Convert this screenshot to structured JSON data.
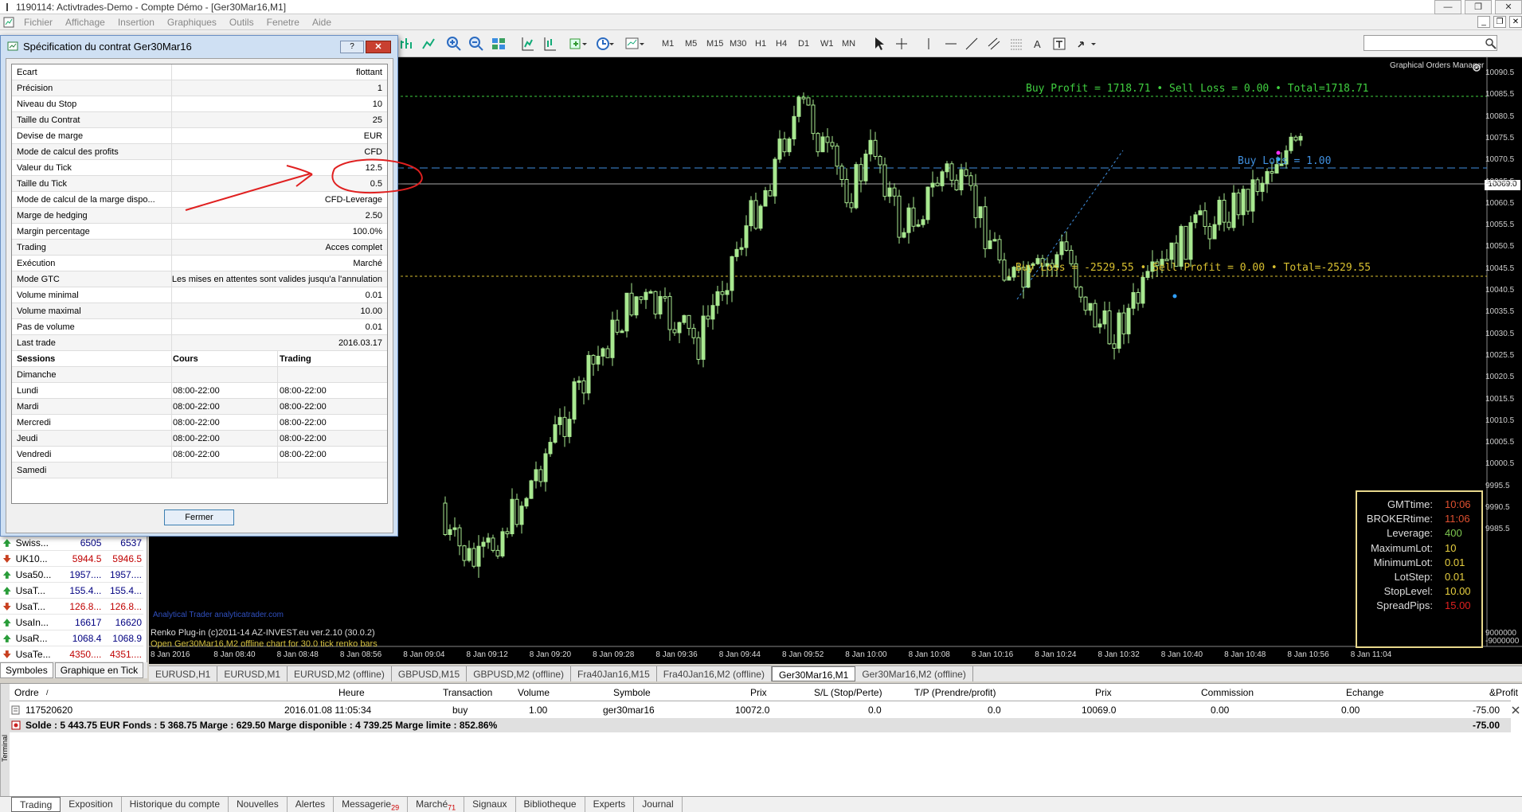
{
  "window": {
    "title": "1190114: Activtrades-Demo - Compte Démo - [Ger30Mar16,M1]",
    "controls": [
      "—",
      "❐",
      "✕"
    ]
  },
  "menu": {
    "items": [
      "Fichier",
      "Affichage",
      "Insertion",
      "Graphiques",
      "Outils",
      "Fenetre",
      "Aide"
    ],
    "mdi_controls": [
      "_",
      "❐",
      "✕"
    ]
  },
  "toolbar": {
    "timeframes": [
      "M1",
      "M5",
      "M15",
      "M30",
      "H1",
      "H4",
      "D1",
      "W1",
      "MN"
    ],
    "text_tool": "A"
  },
  "dialog": {
    "title": "Spécification du contrat Ger30Mar16",
    "help": "?",
    "close": "✕",
    "rows": [
      {
        "key": "Ecart",
        "value": "flottant"
      },
      {
        "key": "Précision",
        "value": "1"
      },
      {
        "key": "Niveau du Stop",
        "value": "10"
      },
      {
        "key": "Taille du Contrat",
        "value": "25"
      },
      {
        "key": "Devise de marge",
        "value": "EUR"
      },
      {
        "key": "Mode de calcul des profits",
        "value": "CFD"
      },
      {
        "key": "Valeur du Tick",
        "value": "12.5"
      },
      {
        "key": "Taille du Tick",
        "value": "0.5"
      },
      {
        "key": "Mode de calcul de la marge dispo...",
        "value": "CFD-Leverage"
      },
      {
        "key": "Marge de hedging",
        "value": "2.50"
      },
      {
        "key": "Margin percentage",
        "value": "100.0%"
      },
      {
        "key": "Trading",
        "value": "Acces complet"
      },
      {
        "key": "Exécution",
        "value": "Marché"
      },
      {
        "key": "Mode GTC",
        "value": "Les mises en attentes sont valides jusqu'a l'annulation"
      },
      {
        "key": "Volume minimal",
        "value": "0.01"
      },
      {
        "key": "Volume maximal",
        "value": "10.00"
      },
      {
        "key": "Pas de volume",
        "value": "0.01"
      },
      {
        "key": "Last trade",
        "value": "2016.03.17"
      }
    ],
    "sessions_header": {
      "day": "Sessions",
      "cours": "Cours",
      "trading": "Trading"
    },
    "sessions": [
      {
        "day": "Dimanche",
        "cours": "",
        "trading": ""
      },
      {
        "day": "Lundi",
        "cours": "08:00-22:00",
        "trading": "08:00-22:00"
      },
      {
        "day": "Mardi",
        "cours": "08:00-22:00",
        "trading": "08:00-22:00"
      },
      {
        "day": "Mercredi",
        "cours": "08:00-22:00",
        "trading": "08:00-22:00"
      },
      {
        "day": "Jeudi",
        "cours": "08:00-22:00",
        "trading": "08:00-22:00"
      },
      {
        "day": "Vendredi",
        "cours": "08:00-22:00",
        "trading": "08:00-22:00"
      },
      {
        "day": "Samedi",
        "cours": "",
        "trading": ""
      }
    ],
    "close_button": "Fermer"
  },
  "navigator": {
    "symbols": [
      {
        "name": "Swiss...",
        "bid": "6505",
        "ask": "6537",
        "bid_color": "#000080",
        "ask_color": "#000080",
        "dir": "up"
      },
      {
        "name": "UK10...",
        "bid": "5944.5",
        "ask": "5946.5",
        "bid_color": "#c00000",
        "ask_color": "#c00000",
        "dir": "down"
      },
      {
        "name": "Usa50...",
        "bid": "1957....",
        "ask": "1957....",
        "bid_color": "#000080",
        "ask_color": "#000080",
        "dir": "up"
      },
      {
        "name": "UsaT...",
        "bid": "155.4...",
        "ask": "155.4...",
        "bid_color": "#000080",
        "ask_color": "#000080",
        "dir": "up"
      },
      {
        "name": "UsaT...",
        "bid": "126.8...",
        "ask": "126.8...",
        "bid_color": "#c00000",
        "ask_color": "#c00000",
        "dir": "down"
      },
      {
        "name": "UsaIn...",
        "bid": "16617",
        "ask": "16620",
        "bid_color": "#000080",
        "ask_color": "#000080",
        "dir": "up"
      },
      {
        "name": "UsaR...",
        "bid": "1068.4",
        "ask": "1068.9",
        "bid_color": "#000080",
        "ask_color": "#000080",
        "dir": "up"
      },
      {
        "name": "UsaTe...",
        "bid": "4350....",
        "ask": "4351....",
        "bid_color": "#c00000",
        "ask_color": "#c00000",
        "dir": "down"
      }
    ],
    "tabs": [
      "Symboles",
      "Graphique en Tick"
    ]
  },
  "chart": {
    "gom_label": "Graphical Orders Manager",
    "buy_profit_label": "Buy Profit = 1718.71 • Sell Loss = 0.00 • Total=1718.71",
    "buy_lots_label": "Buy Lots = 1.00",
    "buy_loss_label": "Buy Loss = -2529.55 • Sell Profit = 0.00 • Total=-2529.55",
    "watermark": "Analytical Trader analyticatrader.com",
    "renko_line": "Renko Plug-in (c)2011-14 AZ-INVEST.eu ver.2.10 (30.0.2)",
    "offline_line": "Open Ger30Mar16,M2 offline chart for 30.0 tick renko bars",
    "current_price": "10069.0",
    "y_ticks": [
      "10090.5",
      "10085.5",
      "10080.5",
      "10075.5",
      "10070.5",
      "10065.5",
      "10060.5",
      "10055.5",
      "10050.5",
      "10045.5",
      "10040.5",
      "10035.5",
      "10030.5",
      "10025.5",
      "10020.5",
      "10015.5",
      "10010.5",
      "10005.5",
      "10000.5",
      "9995.5",
      "9990.5",
      "9985.5",
      "9000000",
      "-9000000"
    ],
    "x_ticks": [
      "8 Jan 2016",
      "8 Jan 08:40",
      "8 Jan 08:48",
      "8 Jan 08:56",
      "8 Jan 09:04",
      "8 Jan 09:12",
      "8 Jan 09:20",
      "8 Jan 09:28",
      "8 Jan 09:36",
      "8 Jan 09:44",
      "8 Jan 09:52",
      "8 Jan 10:00",
      "8 Jan 10:08",
      "8 Jan 10:16",
      "8 Jan 10:24",
      "8 Jan 10:32",
      "8 Jan 10:40",
      "8 Jan 10:48",
      "8 Jan 10:56",
      "8 Jan 11:04"
    ],
    "info": [
      {
        "key": "GMTtime:",
        "value": "10:06",
        "color": "#e05030"
      },
      {
        "key": "BROKERtime:",
        "value": "11:06",
        "color": "#e05030"
      },
      {
        "key": "Leverage:",
        "value": "400",
        "color": "#7ec850"
      },
      {
        "key": "MaximumLot:",
        "value": "10",
        "color": "#e8d040"
      },
      {
        "key": "MinimumLot:",
        "value": "0.01",
        "color": "#e8d040"
      },
      {
        "key": "LotStep:",
        "value": "0.01",
        "color": "#e8d040"
      },
      {
        "key": "StopLevel:",
        "value": "10.00",
        "color": "#e8d040"
      },
      {
        "key": "SpreadPips:",
        "value": "15.00",
        "color": "#e02020"
      }
    ]
  },
  "chart_tabs": {
    "items": [
      "EURUSD,H1",
      "EURUSD,M1",
      "EURUSD,M2 (offline)",
      "GBPUSD,M15",
      "GBPUSD,M2 (offline)",
      "Fra40Jan16,M15",
      "Fra40Jan16,M2 (offline)",
      "Ger30Mar16,M1",
      "Ger30Mar16,M2 (offline)"
    ],
    "active": 7
  },
  "terminal": {
    "side_label": "Terminal",
    "headers": [
      "Ordre",
      "Heure",
      "Transaction",
      "Volume",
      "Symbole",
      "Prix",
      "S/L (Stop/Perte)",
      "T/P (Prendre/profit)",
      "Prix",
      "Commission",
      "Echange",
      "&Profit"
    ],
    "sort_mark": "/",
    "order": {
      "ordre": "117520620",
      "heure": "2016.01.08 11:05:34",
      "transaction": "buy",
      "volume": "1.00",
      "symbole": "ger30mar16",
      "prix": "10072.0",
      "sl": "0.0",
      "tp": "0.0",
      "prix2": "10069.0",
      "commission": "0.00",
      "echange": "0.00",
      "profit": "-75.00"
    },
    "solde": "Solde : 5 443.75 EUR  Fonds : 5 368.75  Marge : 629.50  Marge disponible : 4 739.25  Marge limite : 852.86%",
    "solde_profit": "-75.00",
    "tabs": [
      {
        "label": "Trading",
        "badge": ""
      },
      {
        "label": "Exposition",
        "badge": ""
      },
      {
        "label": "Historique du compte",
        "badge": ""
      },
      {
        "label": "Nouvelles",
        "badge": ""
      },
      {
        "label": "Alertes",
        "badge": ""
      },
      {
        "label": "Messagerie",
        "badge": "29"
      },
      {
        "label": "Marché",
        "badge": "71"
      },
      {
        "label": "Signaux",
        "badge": ""
      },
      {
        "label": "Bibliotheque",
        "badge": ""
      },
      {
        "label": "Experts",
        "badge": ""
      },
      {
        "label": "Journal",
        "badge": ""
      }
    ]
  },
  "colors": {
    "bull_candle": "#a8e890",
    "green_line": "#40d040",
    "blue_line": "#4090e0",
    "yellow_line": "#d8c030"
  }
}
